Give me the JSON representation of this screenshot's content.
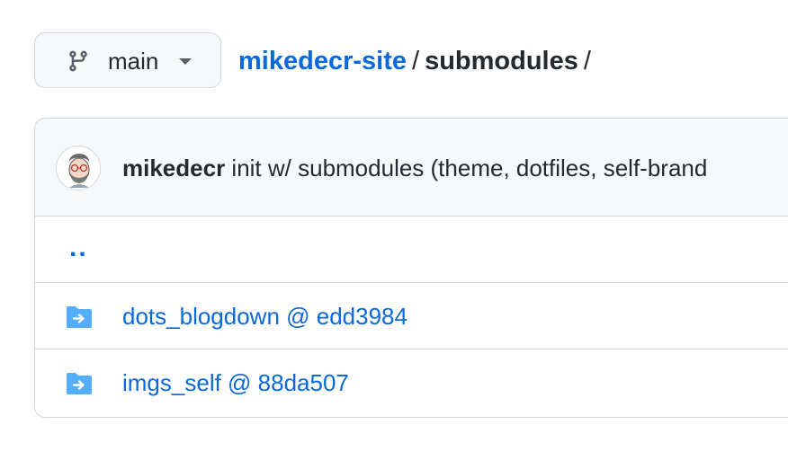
{
  "branch": {
    "label": "main",
    "icon": "git-branch-icon"
  },
  "breadcrumb": {
    "repo": "mikedecr-site",
    "separator": "/",
    "current": "submodules",
    "trailing": "/"
  },
  "commit": {
    "author": "mikedecr",
    "message": "init w/ submodules (theme, dotfiles, self-brand"
  },
  "files": {
    "parent": "..",
    "items": [
      {
        "name": "dots_blogdown @ edd3984",
        "icon": "submodule-folder-icon"
      },
      {
        "name": "imgs_self @ 88da507",
        "icon": "submodule-folder-icon"
      }
    ]
  },
  "colors": {
    "link": "#0969da",
    "text": "#24292f",
    "border": "#d0d7de",
    "header_bg": "#f6f8fa",
    "folder": "#54aeff"
  }
}
